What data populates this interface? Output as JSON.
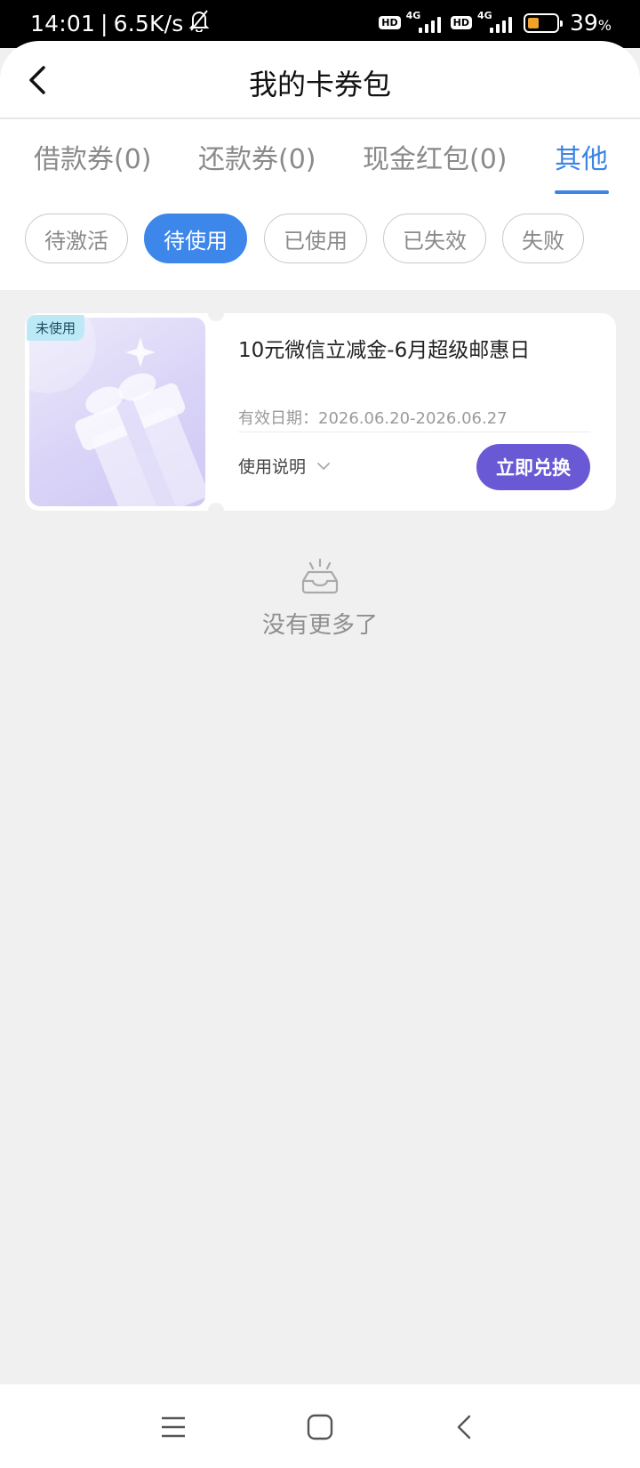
{
  "status_bar": {
    "time": "14:01",
    "separator": "|",
    "net_speed": "6.5K/s",
    "network_left": "4G",
    "network_right": "4G",
    "hd_badge": "HD",
    "battery_percent": "39",
    "battery_unit": "%",
    "battery_level": 0.39,
    "battery_color": "#f0a22b",
    "icons": [
      "bell-off-icon",
      "signal-icon",
      "battery-icon"
    ]
  },
  "header": {
    "title": "我的卡券包",
    "back_icon": "chevron-left-icon"
  },
  "tabs": [
    {
      "label": "借款券(0)",
      "active": false
    },
    {
      "label": "还款券(0)",
      "active": false
    },
    {
      "label": "现金红包(0)",
      "active": false
    },
    {
      "label": "其他",
      "active": true
    }
  ],
  "filters": [
    {
      "label": "待激活",
      "active": false
    },
    {
      "label": "待使用",
      "active": true
    },
    {
      "label": "已使用",
      "active": false
    },
    {
      "label": "已失效",
      "active": false
    },
    {
      "label": "失败",
      "active": false
    }
  ],
  "coupon": {
    "badge": "未使用",
    "title": "10元微信立减金-6月超级邮惠日",
    "validity": "有效日期：2026.06.20-2026.06.27",
    "usage_label": "使用说明",
    "redeem_label": "立即兑换",
    "thumbnail_icon": "gift-icon"
  },
  "list_end": {
    "text": "没有更多了",
    "icon": "empty-box-icon"
  },
  "nav_bar": {
    "icons": [
      "menu-icon",
      "home-icon",
      "back-icon"
    ]
  },
  "colors": {
    "accent": "#3c85e6",
    "active_chip": "#3d87ea",
    "redeem_button": "#6a59d4",
    "badge_bg": "#bde9f7",
    "page_bg": "#f0f0f0"
  }
}
